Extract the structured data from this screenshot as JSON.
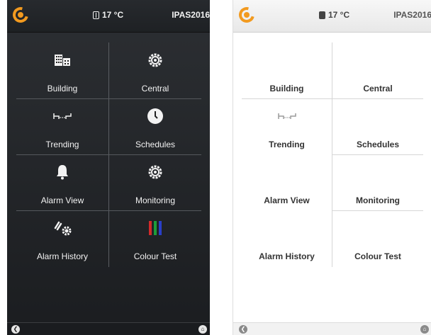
{
  "status": {
    "temperature": "17 °C",
    "site": "IPAS2016"
  },
  "tiles": [
    {
      "label": "Building",
      "icon": "building-icon"
    },
    {
      "label": "Central",
      "icon": "gear-icon"
    },
    {
      "label": "Trending",
      "icon": "trending-icon"
    },
    {
      "label": "Schedules",
      "icon": "clock-icon"
    },
    {
      "label": "Alarm View",
      "icon": "bell-icon"
    },
    {
      "label": "Monitoring",
      "icon": "gear-icon"
    },
    {
      "label": "Alarm History",
      "icon": "link-gear-icon"
    },
    {
      "label": "Colour Test",
      "icon": "colour-bars-icon"
    }
  ],
  "nav": {
    "back_icon": "back-arrow-icon",
    "home_icon": "home-icon"
  },
  "colors": {
    "accent": "#f29a1f",
    "bar_red": "#d42a2a",
    "bar_green": "#1e9e3a",
    "bar_blue": "#2a3fc9"
  }
}
